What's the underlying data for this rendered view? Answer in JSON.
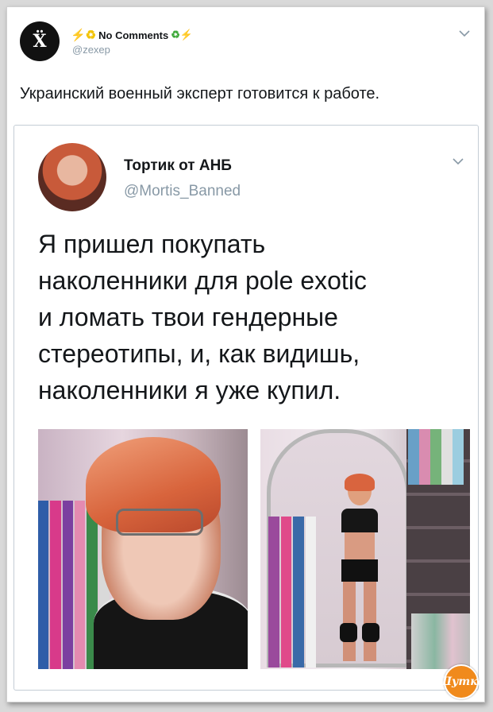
{
  "outer_tweet": {
    "avatar_letter": "Ẍ",
    "display_name": "No Comments",
    "name_decor_left": "⚡♻",
    "name_decor_right": "♻⚡",
    "handle": "@zexep",
    "text": "Украинский военный эксперт готовится к работе."
  },
  "quoted_tweet": {
    "display_name": "Тортик от АНБ",
    "handle": "@Mortis_Banned",
    "text_lines": [
      "Я пришел покупать",
      "наколенники для pole exotic",
      "и ломать твои гендерные",
      "стереотипы, и, как видишь,",
      "наколенники я уже купил."
    ]
  },
  "watermark": {
    "text": "Шутка"
  },
  "colors": {
    "handle_gray": "#8899a6",
    "text_dark": "#14171a",
    "card_border": "#c4cdd5",
    "watermark_orange": "#f08a1c"
  },
  "icons": [
    "chevron-down-icon",
    "bolt-icon",
    "recycle-icon"
  ]
}
